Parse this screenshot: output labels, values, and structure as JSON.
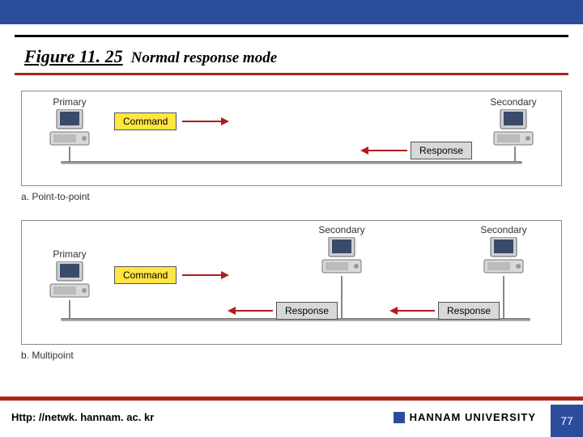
{
  "header": {
    "figure_label": "Figure 11. 25",
    "figure_title": "Normal response mode"
  },
  "panelA": {
    "primary_label": "Primary",
    "secondary_label": "Secondary",
    "command_label": "Command",
    "response_label": "Response",
    "caption": "a. Point-to-point"
  },
  "panelB": {
    "primary_label": "Primary",
    "secondary1_label": "Secondary",
    "secondary2_label": "Secondary",
    "command_label": "Command",
    "response1_label": "Response",
    "response2_label": "Response",
    "caption": "b. Multipoint"
  },
  "footer": {
    "url": "Http: //netwk. hannam. ac. kr",
    "university": "HANNAM  UNIVERSITY",
    "page": "77"
  },
  "colors": {
    "accent_blue": "#2c4c9c",
    "accent_red": "#b02418",
    "yellow": "#ffe640",
    "arrow_red": "#b21c1c"
  }
}
